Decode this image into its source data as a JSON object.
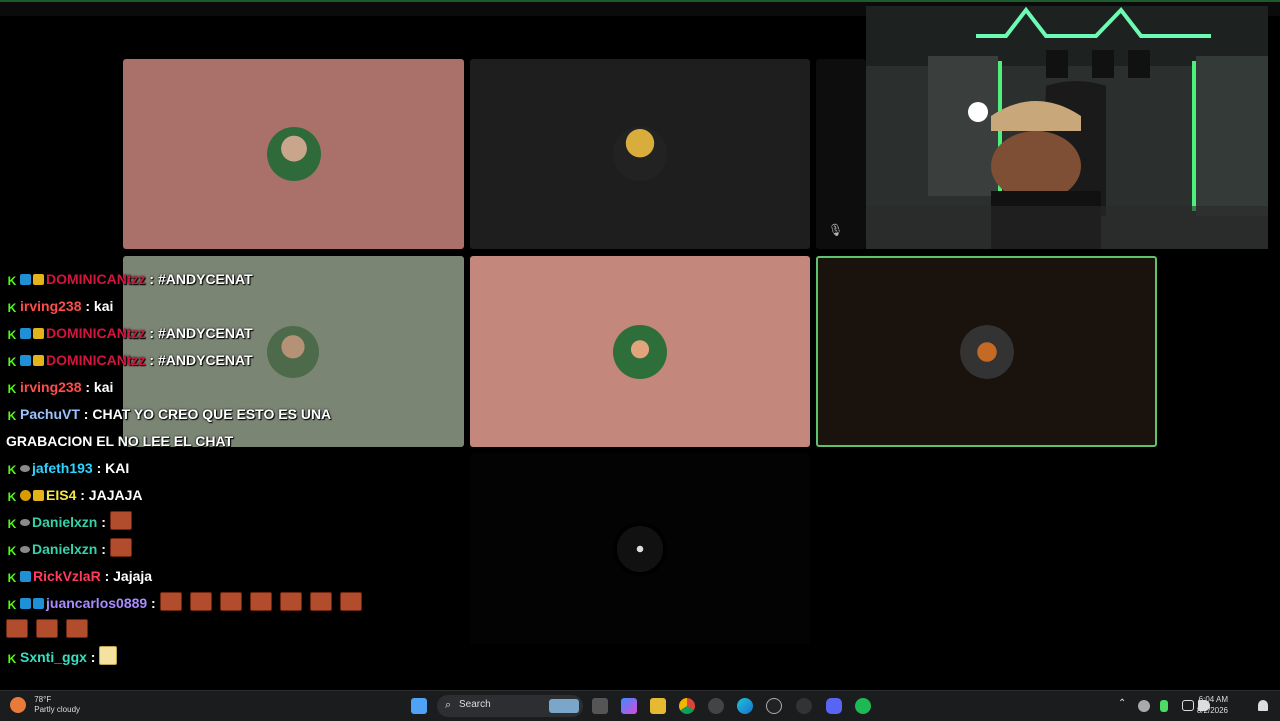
{
  "chat": {
    "messages": [
      {
        "badges": [
          "k",
          "blue",
          "crown"
        ],
        "user": "DOMINICANtzz",
        "user_color": "#d4143c",
        "text": ": #ANDYCENAT",
        "emotes": 0
      },
      {
        "badges": [
          "k"
        ],
        "user": "irving238",
        "user_color": "#ff4c4c",
        "text": ": kai",
        "emotes": 0
      },
      {
        "badges": [
          "k",
          "blue",
          "crown"
        ],
        "user": "DOMINICANtzz",
        "user_color": "#d4143c",
        "text": ": #ANDYCENAT",
        "emotes": 0
      },
      {
        "badges": [
          "k",
          "blue",
          "crown"
        ],
        "user": "DOMINICANtzz",
        "user_color": "#d4143c",
        "text": ": #ANDYCENAT",
        "emotes": 0
      },
      {
        "badges": [
          "k"
        ],
        "user": "irving238",
        "user_color": "#ff4c4c",
        "text": ": kai",
        "emotes": 0
      },
      {
        "badges": [
          "k"
        ],
        "user": "PachuVT",
        "user_color": "#9cc3ff",
        "text": ": CHAT YO CREO QUE ESTO ES UNA GRABACION EL NO LEE EL CHAT",
        "emotes": 0
      },
      {
        "badges": [
          "k",
          "grey"
        ],
        "user": "jafeth193",
        "user_color": "#2fd3ff",
        "text": ": KAI",
        "emotes": 0
      },
      {
        "badges": [
          "k",
          "gold",
          "crown"
        ],
        "user": "EIS4",
        "user_color": "#f5e842",
        "text": ": JAJAJA",
        "emotes": 0
      },
      {
        "badges": [
          "k",
          "grey"
        ],
        "user": "Danielxzn",
        "user_color": "#36d1a8",
        "text": ":",
        "emotes": 1
      },
      {
        "badges": [
          "k",
          "grey"
        ],
        "user": "Danielxzn",
        "user_color": "#36d1a8",
        "text": ":",
        "emotes": 1
      },
      {
        "badges": [
          "k",
          "blue"
        ],
        "user": "RickVzlaR",
        "user_color": "#ff3b5c",
        "text": ": Jajaja",
        "emotes": 0
      },
      {
        "badges": [
          "k",
          "blue",
          "qr"
        ],
        "user": "juancarlos0889",
        "user_color": "#a98bff",
        "text": ":",
        "emotes": 10
      },
      {
        "badges": [
          "k"
        ],
        "user": "Sxnti_ggx",
        "user_color": "#37e0c0",
        "text": ":",
        "emotes": -1
      }
    ]
  },
  "taskbar": {
    "weather_temp": "78°F",
    "weather_desc": "Partly cloudy",
    "search_placeholder": "Search",
    "time": "6:04 AM",
    "date": "8/2/2026"
  },
  "colors": {
    "tile_salmon": "#a97169",
    "tile_dark": "#1e1e1e",
    "tile_sage": "#7a8574",
    "tile_pink": "#c3877c",
    "tile_brown": "#1a120d",
    "speaking_border": "#5cc56c"
  }
}
